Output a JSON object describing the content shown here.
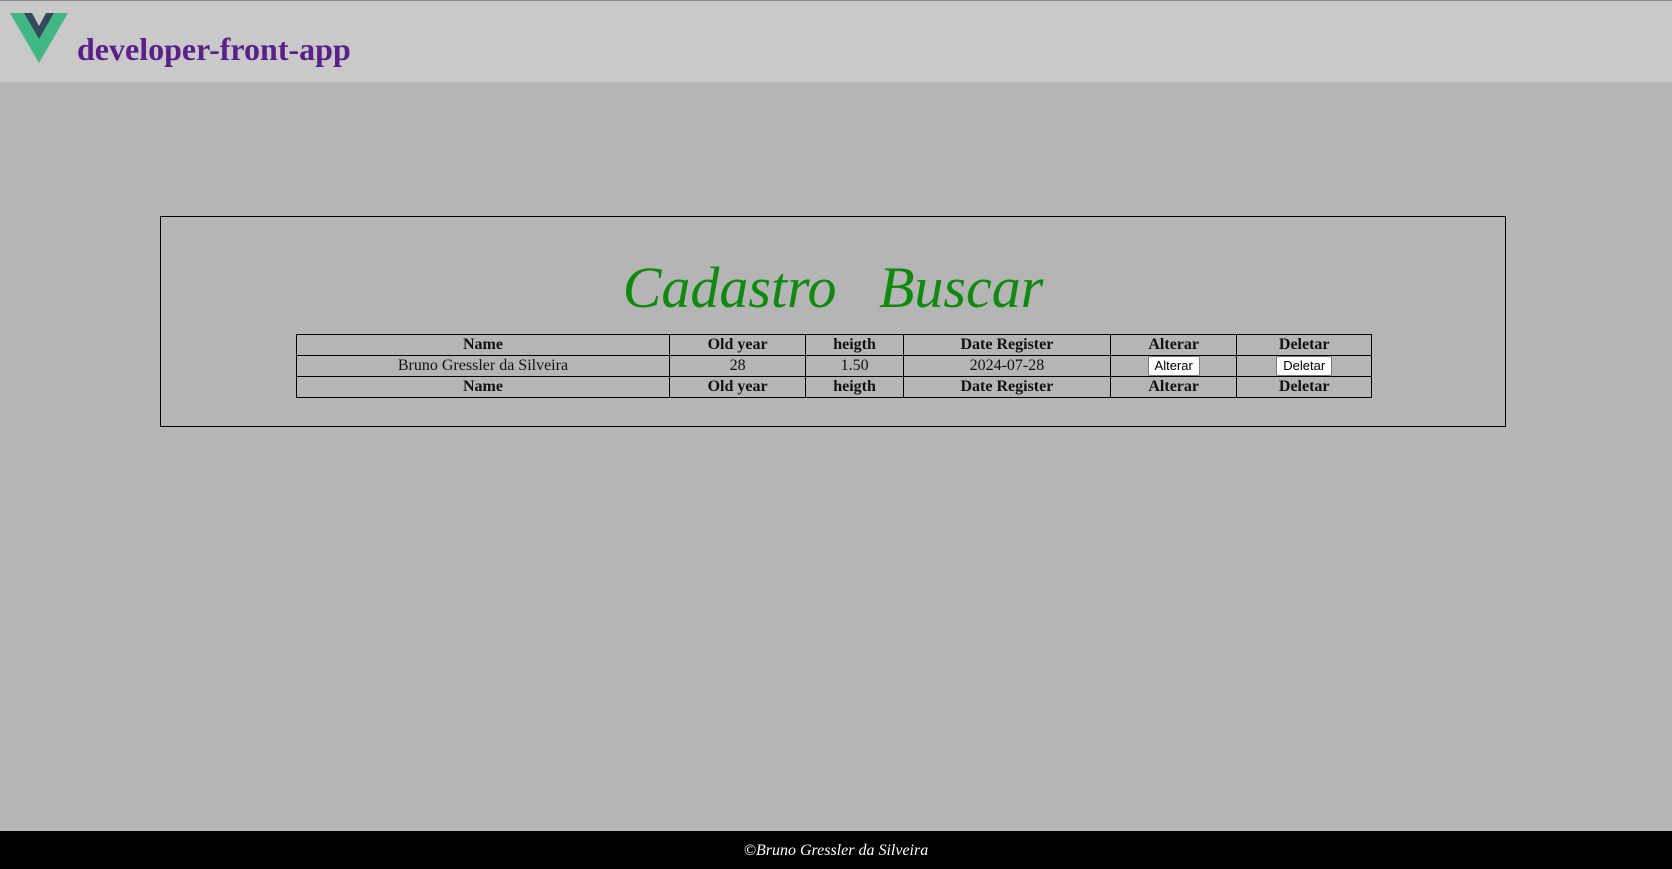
{
  "header": {
    "logo_icon": "vue-logo-icon",
    "title": "developer-front-app",
    "title_color": "#5b1f8a"
  },
  "main": {
    "nav": {
      "cadastro": "Cadastro",
      "buscar": "Buscar",
      "color": "#0f8a0f"
    },
    "table": {
      "headers": {
        "name": "Name",
        "old_year": "Old year",
        "heigth": "heigth",
        "date_register": "Date Register",
        "alterar": "Alterar",
        "deletar": "Deletar"
      },
      "rows": [
        {
          "name": "Bruno Gressler da Silveira",
          "old_year": "28",
          "heigth": "1.50",
          "date_register": "2024-07-28",
          "alterar_button": "Alterar",
          "deletar_button": "Deletar"
        }
      ],
      "footer": {
        "name": "Name",
        "old_year": "Old year",
        "heigth": "heigth",
        "date_register": "Date Register",
        "alterar": "Alterar",
        "deletar": "Deletar"
      }
    }
  },
  "footer": {
    "text": "©Bruno Gressler da Silveira"
  }
}
